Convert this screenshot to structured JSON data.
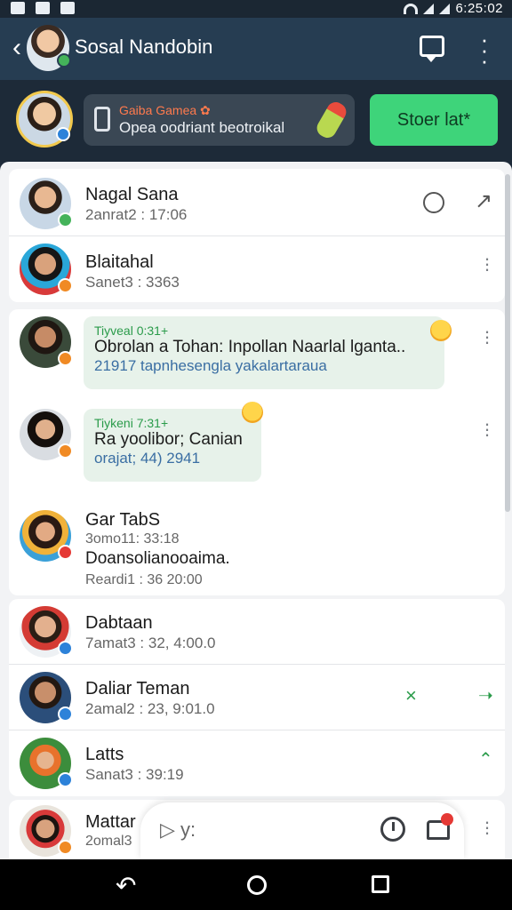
{
  "status_bar": {
    "time": "6:25:02"
  },
  "header": {
    "title": "Sosal Nandobin"
  },
  "promo": {
    "kicker": "Gaiba Gamea ✿",
    "subtitle": "Opea oodriant beotroikal",
    "button_label": "Stoer lat*"
  },
  "contacts_card_1": [
    {
      "name": "Nagal Sana",
      "meta": "2anrat2 : 17:06",
      "badge_color": "#44b35a"
    },
    {
      "name": "Blaitahal",
      "meta": "Sanet3 : 3363",
      "badge_color": "#f08a24"
    }
  ],
  "chats": [
    {
      "tag": "Tiyveal 0:31+",
      "line1": "Obrolan a Tohan: Inpollan Naarlal lganta..",
      "line2": "21917 tapnhesengla yakalartaraua",
      "badge_color": "#f08a24"
    },
    {
      "tag": "Tiykeni 7:31+",
      "line1": "Ra yoolibor; Canian",
      "line2": "orajat; 44) 2941",
      "badge_color": "#f08a24"
    }
  ],
  "thread": {
    "name": "Gar TabS",
    "meta": "3omo11: 33:18",
    "preview": "Doansolianooaima.",
    "time": "Reardi1 : 36 20:00",
    "badge_color": "#e53935"
  },
  "contacts_card_2": [
    {
      "name": "Dabtaan",
      "meta": "7amat3 : 32, 4:00.0",
      "badge_color": "#2d82d9",
      "action": ""
    },
    {
      "name": "Daliar Teman",
      "meta": "2amal2 : 23, 9:01.0",
      "badge_color": "#2d82d9",
      "action": "×"
    },
    {
      "name": "Latts",
      "meta": "Sanat3 : 39:19",
      "badge_color": "#2d82d9",
      "action": ""
    }
  ],
  "last_contact": {
    "name": "Mattar",
    "meta": "2omal3",
    "badge_color": "#f08a24"
  },
  "compose": {
    "hint": "▷ y:"
  }
}
